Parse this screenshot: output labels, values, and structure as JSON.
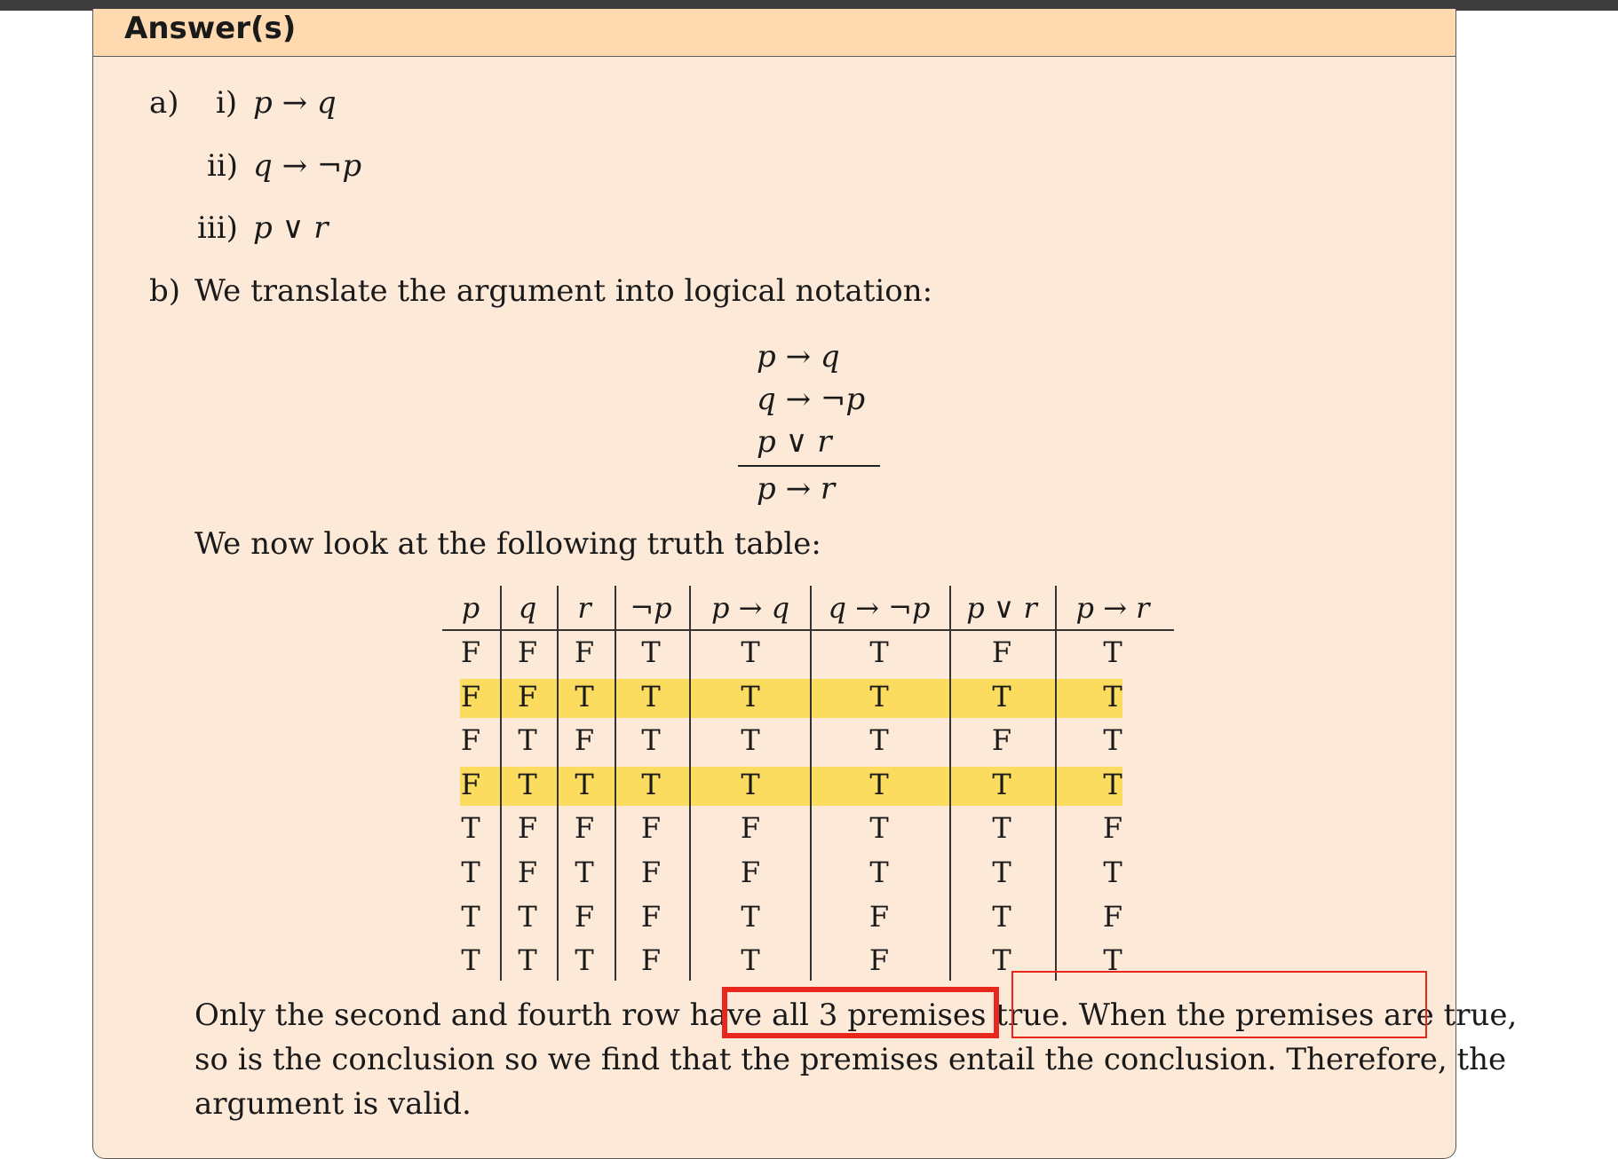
{
  "header": {
    "title": "Answer(s)"
  },
  "part_a": {
    "label": "a)",
    "items": [
      {
        "num": "i)",
        "expr": "p → q"
      },
      {
        "num": "ii)",
        "expr": "q → ¬p"
      },
      {
        "num": "iii)",
        "expr": "p ∨ r"
      }
    ]
  },
  "part_b": {
    "label": "b)",
    "intro": "We translate the argument into logical notation:",
    "premises": [
      "p → q",
      "q → ¬p",
      "p ∨ r"
    ],
    "conclusion": "p → r",
    "table_intro": "We now look at the following truth table:"
  },
  "truth_table": {
    "headers": [
      "p",
      "q",
      "r",
      "¬p",
      "p → q",
      "q → ¬p",
      "p ∨ r",
      "p → r"
    ],
    "rows": [
      [
        "F",
        "F",
        "F",
        "T",
        "T",
        "T",
        "F",
        "T"
      ],
      [
        "F",
        "F",
        "T",
        "T",
        "T",
        "T",
        "T",
        "T"
      ],
      [
        "F",
        "T",
        "F",
        "T",
        "T",
        "T",
        "F",
        "T"
      ],
      [
        "F",
        "T",
        "T",
        "T",
        "T",
        "T",
        "T",
        "T"
      ],
      [
        "T",
        "F",
        "F",
        "F",
        "F",
        "T",
        "T",
        "F"
      ],
      [
        "T",
        "F",
        "T",
        "F",
        "F",
        "T",
        "T",
        "T"
      ],
      [
        "T",
        "T",
        "F",
        "F",
        "T",
        "F",
        "T",
        "F"
      ],
      [
        "T",
        "T",
        "T",
        "F",
        "T",
        "F",
        "T",
        "T"
      ]
    ],
    "highlighted_rows": [
      1,
      3
    ],
    "highlight_color": "#fbdc5e"
  },
  "conclusion": {
    "line1_pre": "Only the second and fourth row have ",
    "line1_box1": "all 3 premises true",
    "line1_mid": ". ",
    "line1_box2": "When the premises are true,",
    "line2": "so is the conclusion so we find that the premises entail the conclusion.  Therefore, the",
    "line3": "argument is valid."
  },
  "annotation_color": "#e8281e"
}
